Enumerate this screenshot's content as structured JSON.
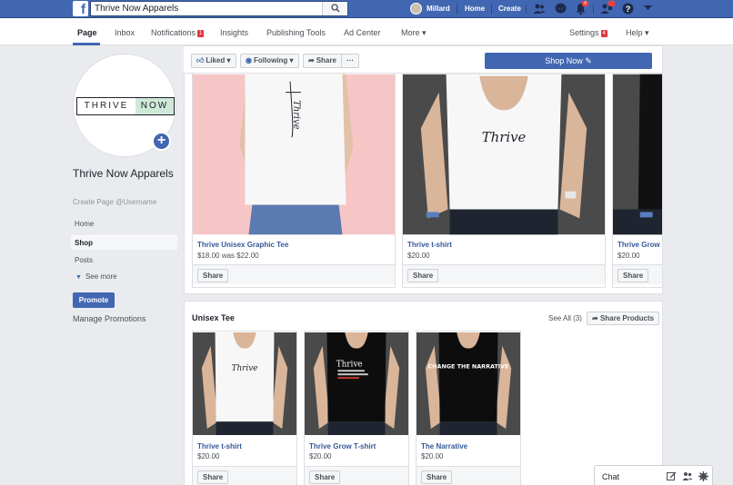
{
  "topbar": {
    "search_value": "Thrive Now Apparels",
    "user_name": "Millard",
    "home_label": "Home",
    "create_label": "Create",
    "notif_count": "4"
  },
  "page_tabs": {
    "page": "Page",
    "inbox": "Inbox",
    "notifications": "Notifications",
    "notifications_badge": "1",
    "insights": "Insights",
    "publishing_tools": "Publishing Tools",
    "ad_center": "Ad Center",
    "more": "More ▾",
    "settings": "Settings",
    "settings_badge": "4",
    "help": "Help ▾"
  },
  "profile": {
    "logo_word1": "THRIVE",
    "logo_word2": "NOW",
    "page_name": "Thrive Now Apparels",
    "username_link": "Create Page @Username"
  },
  "left_nav": {
    "home": "Home",
    "shop": "Shop",
    "posts": "Posts",
    "see_more": "See more",
    "promote": "Promote",
    "manage_promotions": "Manage Promotions"
  },
  "action_bar": {
    "liked": "Liked ▾",
    "following": "Following ▾",
    "share": "Share",
    "more": "···",
    "shop_now": "Shop Now ✎"
  },
  "featured_products": [
    {
      "name": "Thrive Unisex Graphic Tee",
      "price": "$18.00",
      "was": "was $22.00",
      "share": "Share",
      "print": "Thrive"
    },
    {
      "name": "Thrive t-shirt",
      "price": "$20.00",
      "share": "Share",
      "print": "Thrive"
    },
    {
      "name": "Thrive Grow T",
      "price": "$20.00",
      "share": "Share",
      "print": ""
    }
  ],
  "section": {
    "title": "Unisex Tee",
    "see_all": "See All (3)",
    "share_products": "Share Products"
  },
  "section_products": [
    {
      "name": "Thrive t-shirt",
      "price": "$20.00",
      "share": "Share",
      "print": "Thrive"
    },
    {
      "name": "Thrive Grow T-shirt",
      "price": "$20.00",
      "share": "Share",
      "print": "Thrive"
    },
    {
      "name": "The Narrative",
      "price": "$20.00",
      "share": "Share",
      "print": "CHANGE THE NARRATIVE"
    }
  ],
  "chat": {
    "label": "Chat"
  },
  "colors": {
    "brand": "#4267b2",
    "pink_bg": "#f6c6c7",
    "dark_bg": "#4a4a4a",
    "badge_red": "#e0393e"
  }
}
